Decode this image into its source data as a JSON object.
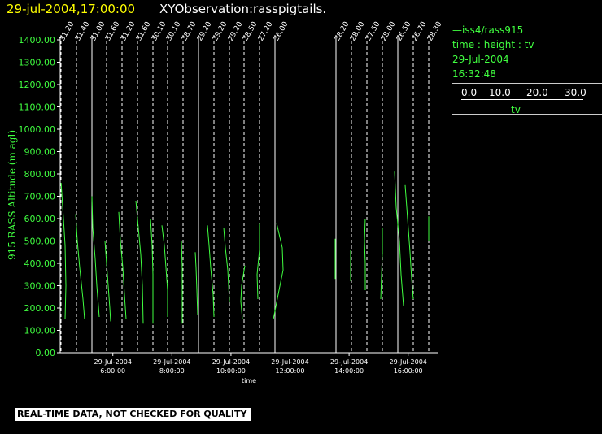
{
  "header": {
    "time": "29-jul-2004,17:00:00",
    "observation": "XYObservation:rasspigtails."
  },
  "legend": {
    "line_label": "—iss4/rass915",
    "variables": "time : height : tv",
    "date": "29-Jul-2004",
    "time": "16:32:48",
    "scale_ticks": [
      "0.0",
      "10.0",
      "20.0",
      "30.0"
    ],
    "scale_label": "tv"
  },
  "footer": {
    "quality_note": "REAL-TIME DATA, NOT CHECKED FOR QUALITY"
  },
  "colors": {
    "trace": "#40ff40",
    "axis": "#ffffff",
    "ref": "#ffffff",
    "title_time": "#ffff00"
  },
  "chart_data": {
    "type": "line",
    "title": "",
    "ylabel": "915 RASS Altitude (m agl)",
    "xlabel": "time",
    "ylim": [
      0,
      1400
    ],
    "xlim": [
      "29-Jul-2004 04:13",
      "29-Jul-2004 17:00"
    ],
    "y_ticks": [
      "0.00",
      "100.00",
      "200.00",
      "300.00",
      "400.00",
      "500.00",
      "600.00",
      "700.00",
      "800.00",
      "900.00",
      "1000.00",
      "1100.00",
      "1200.00",
      "1300.00",
      "1400.00"
    ],
    "x_ticks": [
      {
        "date": "29-Jul-2004",
        "time": "6:00:00"
      },
      {
        "date": "29-Jul-2004",
        "time": "8:00:00"
      },
      {
        "date": "29-Jul-2004",
        "time": "10:00:00"
      },
      {
        "date": "29-Jul-2004",
        "time": "12:00:00"
      },
      {
        "date": "29-Jul-2004",
        "time": "14:00:00"
      },
      {
        "date": "29-Jul-2004",
        "time": "16:00:00"
      }
    ],
    "series": [
      {
        "label": "31.20",
        "ref": "dashed",
        "tail": [
          [
            760,
            0.1
          ],
          [
            600,
            3
          ],
          [
            480,
            5
          ],
          [
            300,
            6
          ],
          [
            150,
            5
          ]
        ]
      },
      {
        "label": "31.40",
        "ref": "dashed",
        "tail": [
          [
            620,
            -1
          ],
          [
            500,
            1
          ],
          [
            380,
            4
          ],
          [
            240,
            8
          ],
          [
            150,
            10
          ]
        ]
      },
      {
        "label": "31.00",
        "ref": "solid",
        "tail": [
          [
            700,
            0
          ],
          [
            560,
            1
          ],
          [
            420,
            4
          ],
          [
            300,
            6
          ],
          [
            160,
            9
          ]
        ]
      },
      {
        "label": "31.60",
        "ref": "dashed",
        "tail": [
          [
            500,
            -2
          ],
          [
            400,
            0
          ],
          [
            300,
            2
          ],
          [
            200,
            4
          ],
          [
            140,
            5
          ]
        ]
      },
      {
        "label": "31.20",
        "ref": "dashed",
        "tail": [
          [
            630,
            -4
          ],
          [
            500,
            -2
          ],
          [
            380,
            1
          ],
          [
            260,
            3
          ],
          [
            150,
            5
          ]
        ]
      },
      {
        "label": "31.60",
        "ref": "dashed",
        "tail": [
          [
            680,
            -2
          ],
          [
            560,
            1
          ],
          [
            440,
            4
          ],
          [
            300,
            6
          ],
          [
            130,
            7
          ]
        ]
      },
      {
        "label": "30.10",
        "ref": "dashed",
        "tail": [
          [
            600,
            -3
          ],
          [
            480,
            -1
          ],
          [
            350,
            0
          ],
          [
            230,
            0
          ],
          [
            130,
            0
          ]
        ]
      },
      {
        "label": "30.10",
        "ref": "dashed",
        "tail": [
          [
            570,
            -7
          ],
          [
            480,
            -4
          ],
          [
            380,
            -2
          ],
          [
            280,
            0
          ],
          [
            160,
            0
          ]
        ]
      },
      {
        "label": "28.70",
        "ref": "dashed",
        "tail": [
          [
            500,
            -2
          ],
          [
            380,
            -1
          ],
          [
            260,
            -1
          ],
          [
            130,
            -1
          ]
        ]
      },
      {
        "label": "29.20",
        "ref": "solid",
        "tail": [
          [
            450,
            -4
          ],
          [
            380,
            -3
          ],
          [
            280,
            -2
          ],
          [
            170,
            -1
          ]
        ]
      },
      {
        "label": "29.20",
        "ref": "dashed",
        "tail": [
          [
            570,
            -8
          ],
          [
            480,
            -6
          ],
          [
            380,
            -4
          ],
          [
            260,
            -1
          ],
          [
            160,
            0
          ]
        ]
      },
      {
        "label": "29.20",
        "ref": "dashed",
        "tail": [
          [
            560,
            -7
          ],
          [
            470,
            -5
          ],
          [
            370,
            -2
          ],
          [
            230,
            0
          ]
        ]
      },
      {
        "label": "28.50",
        "ref": "dashed",
        "tail": [
          [
            390,
            1
          ],
          [
            300,
            -3
          ],
          [
            230,
            -4
          ],
          [
            150,
            -2
          ]
        ]
      },
      {
        "label": "27.20",
        "ref": "dashed",
        "tail": [
          [
            580,
            0
          ],
          [
            460,
            0
          ],
          [
            350,
            -3
          ],
          [
            240,
            -2
          ]
        ]
      },
      {
        "label": "26.00",
        "ref": "solid",
        "tail": [
          [
            580,
            2
          ],
          [
            470,
            9
          ],
          [
            370,
            10
          ],
          [
            280,
            5
          ],
          [
            150,
            -2
          ]
        ]
      },
      {
        "label": "28.20",
        "ref": "solid",
        "tail": [
          [
            510,
            -1
          ],
          [
            420,
            -1
          ],
          [
            330,
            -1
          ]
        ]
      },
      {
        "label": "28.00",
        "ref": "dashed",
        "tail": [
          [
            460,
            -1
          ],
          [
            380,
            -1
          ],
          [
            320,
            -1
          ]
        ]
      },
      {
        "label": "27.50",
        "ref": "dashed",
        "tail": [
          [
            600,
            -2
          ],
          [
            500,
            -3
          ],
          [
            400,
            -2
          ],
          [
            280,
            -2
          ]
        ]
      },
      {
        "label": "28.00",
        "ref": "dashed",
        "tail": [
          [
            560,
            0
          ],
          [
            450,
            0
          ],
          [
            350,
            -1
          ],
          [
            240,
            -2
          ]
        ]
      },
      {
        "label": "26.50",
        "ref": "solid",
        "tail": [
          [
            810,
            -4
          ],
          [
            650,
            -2
          ],
          [
            500,
            2
          ],
          [
            350,
            4
          ],
          [
            210,
            7
          ]
        ]
      },
      {
        "label": "26.70",
        "ref": "dashed",
        "tail": [
          [
            750,
            -10
          ],
          [
            600,
            -7
          ],
          [
            450,
            -4
          ],
          [
            330,
            -2
          ],
          [
            240,
            0
          ]
        ]
      },
      {
        "label": "28.30",
        "ref": "dashed",
        "tail": [
          [
            610,
            0
          ],
          [
            500,
            0
          ]
        ]
      }
    ]
  }
}
